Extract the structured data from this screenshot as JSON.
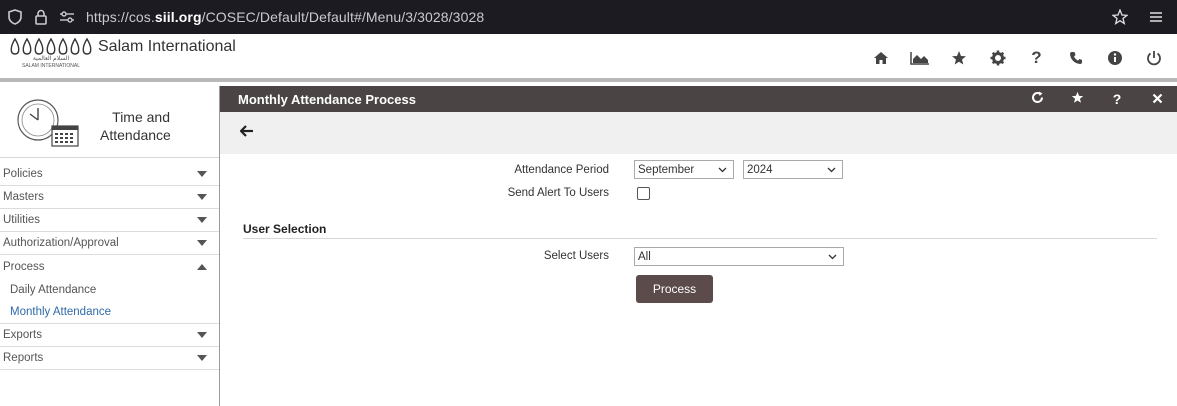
{
  "browser": {
    "url_prefix": "https://cos.",
    "url_domain": "siil.org",
    "url_path": "/COSEC/Default/Default#/Menu/3/3028/3028"
  },
  "header": {
    "company_name": "Salam International",
    "logo_caption_ar": "السلام العالمية",
    "logo_caption_en": "SALAM INTERNATIONAL"
  },
  "module": {
    "line1": "Time and",
    "line2": "Attendance"
  },
  "sidebar": {
    "items": [
      {
        "label": "Policies"
      },
      {
        "label": "Masters"
      },
      {
        "label": "Utilities"
      },
      {
        "label": "Authorization/Approval"
      },
      {
        "label": "Process"
      },
      {
        "label": "Exports"
      },
      {
        "label": "Reports"
      }
    ],
    "sub_items": [
      {
        "label": "Daily Attendance"
      },
      {
        "label": "Monthly Attendance"
      }
    ]
  },
  "page": {
    "title": "Monthly Attendance Process"
  },
  "form": {
    "attendance_period_label": "Attendance Period",
    "month_value": "September",
    "year_value": "2024",
    "send_alert_label": "Send Alert To Users",
    "user_selection_title": "User Selection",
    "select_users_label": "Select Users",
    "select_users_value": "All",
    "process_button": "Process"
  },
  "colors": {
    "title_bar": "#4a4544",
    "active_link": "#2f6aa8",
    "process_button": "#5b4b4b"
  }
}
